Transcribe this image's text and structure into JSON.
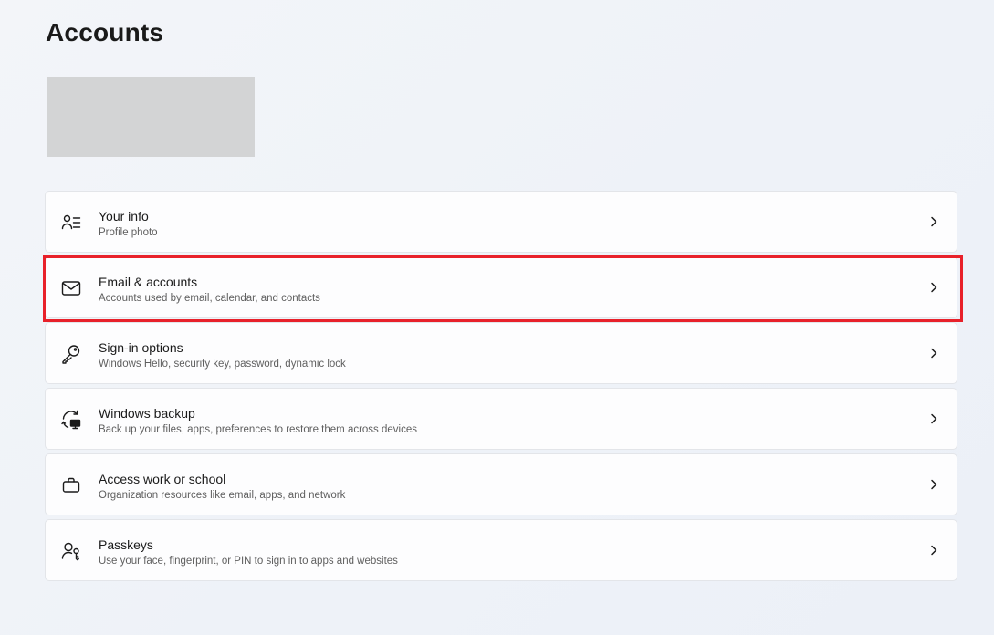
{
  "header": {
    "title": "Accounts"
  },
  "items": [
    {
      "title": "Your info",
      "subtitle": "Profile photo",
      "icon": "person-lines-icon"
    },
    {
      "title": "Email & accounts",
      "subtitle": "Accounts used by email, calendar, and contacts",
      "icon": "mail-icon"
    },
    {
      "title": "Sign-in options",
      "subtitle": "Windows Hello, security key, password, dynamic lock",
      "icon": "key-icon"
    },
    {
      "title": "Windows backup",
      "subtitle": "Back up your files, apps, preferences to restore them across devices",
      "icon": "backup-icon"
    },
    {
      "title": "Access work or school",
      "subtitle": "Organization resources like email, apps, and network",
      "icon": "briefcase-icon"
    },
    {
      "title": "Passkeys",
      "subtitle": "Use your face, fingerprint, or PIN to sign in to apps and websites",
      "icon": "passkey-icon"
    }
  ],
  "highlight": {
    "color": "#e8212a",
    "target": "Email & accounts"
  }
}
